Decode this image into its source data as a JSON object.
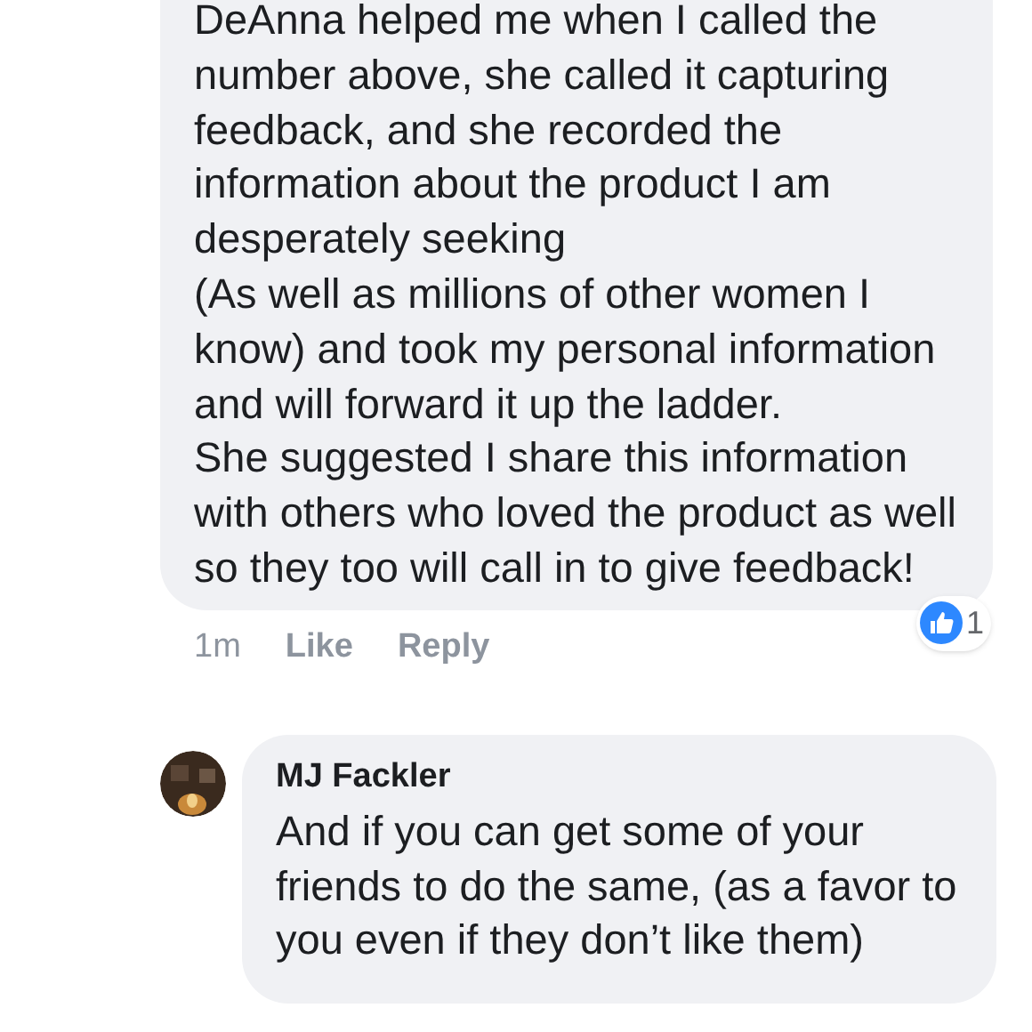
{
  "comments": [
    {
      "paragraphs": [
        "DeAnna helped me when I called the number above, she called it capturing feedback, and she recorded the information about the product I am desperately seeking",
        "(As well as millions of other women I know) and took my personal information and will forward it up the ladder.",
        "She suggested I share this information with others who loved the product as well so they too will call in to give feedback!"
      ],
      "time": "1m",
      "actions": [
        "Like",
        "Reply"
      ],
      "reaction_count": "1"
    },
    {
      "author": "MJ Fackler",
      "paragraphs": [
        "And if you can get some of your friends to do the same, (as a favor to you even if they don’t like them)"
      ]
    }
  ]
}
